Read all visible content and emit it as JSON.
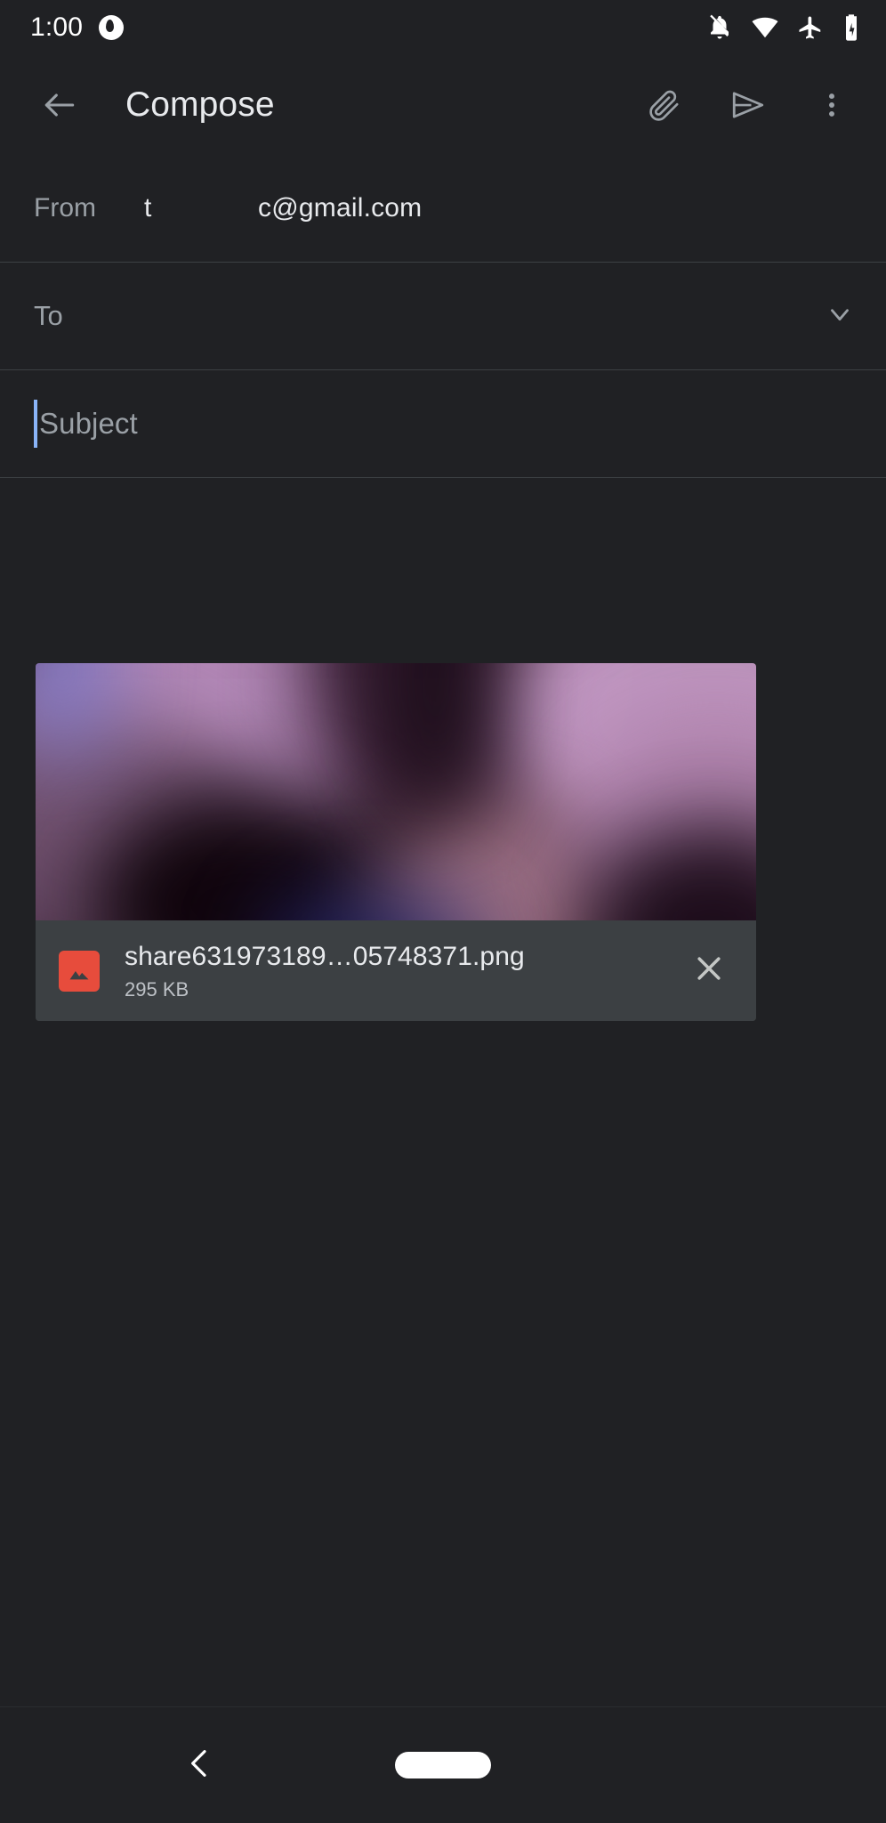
{
  "status_bar": {
    "time": "1:00",
    "app_badge_icon": "app-circle-icon",
    "icons": [
      {
        "name": "notifications-off-icon",
        "label": "Notifications silenced"
      },
      {
        "name": "wifi-icon",
        "label": "Wi-Fi connected"
      },
      {
        "name": "airplane-mode-icon",
        "label": "Airplane mode on"
      },
      {
        "name": "battery-charging-icon",
        "label": "Battery charging"
      }
    ]
  },
  "app_bar": {
    "back_icon": "arrow-back-icon",
    "title": "Compose",
    "actions": [
      {
        "name": "attach-file-button",
        "icon": "paperclip-icon",
        "label": "Attach file"
      },
      {
        "name": "send-button",
        "icon": "send-icon",
        "label": "Send"
      },
      {
        "name": "more-options-button",
        "icon": "overflow-menu-icon",
        "label": "More options"
      }
    ]
  },
  "compose": {
    "from": {
      "label": "From",
      "value": "t              c@gmail.com"
    },
    "to": {
      "placeholder": "To",
      "value": "",
      "expand_icon": "chevron-down-icon"
    },
    "subject": {
      "placeholder": "Subject",
      "value": "",
      "caret_color": "#8ab4f8",
      "focused": true
    },
    "body": {
      "placeholder": "",
      "value": ""
    }
  },
  "attachment": {
    "file_name": "share631973189…05748371.png",
    "file_size": "295 KB",
    "file_type_icon": "image-file-icon",
    "file_type_icon_color": "#e74c3c",
    "remove_icon": "close-icon",
    "preview_alt": "Blurred purple and pink photo thumbnail"
  },
  "nav_bar": {
    "back_icon": "nav-back-chevron-icon",
    "home_indicator": "home-pill-indicator"
  },
  "theme": {
    "background": "#202124",
    "surface": "#3c4043",
    "text_primary": "#e8eaed",
    "text_secondary": "#9aa0a6",
    "divider": "#3c4043",
    "accent": "#8ab4f8"
  }
}
